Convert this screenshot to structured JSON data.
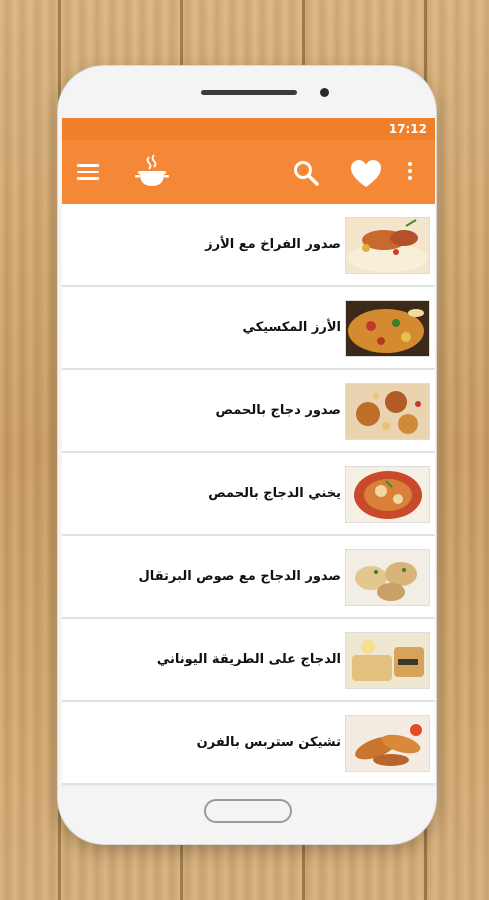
{
  "statusbar": {
    "time": "17:12"
  },
  "appbar": {
    "menu_icon": "hamburger-menu-icon",
    "logo_icon": "cooking-pot-icon",
    "search_icon": "search-icon",
    "favorites_icon": "heart-icon",
    "more_icon": "more-vertical-icon",
    "accent_color": "#f48836"
  },
  "recipes": [
    {
      "title": "صدور الفراخ مع الأرز"
    },
    {
      "title": "الأرز المكسيكي"
    },
    {
      "title": "صدور دجاج بالحمص"
    },
    {
      "title": "يخني الدجاج بالحمص"
    },
    {
      "title": "صدور الدجاج مع صوص البرتقال"
    },
    {
      "title": "الدجاج على الطريقة اليوناني"
    },
    {
      "title": "تشيكن ستربس بالفرن"
    }
  ]
}
